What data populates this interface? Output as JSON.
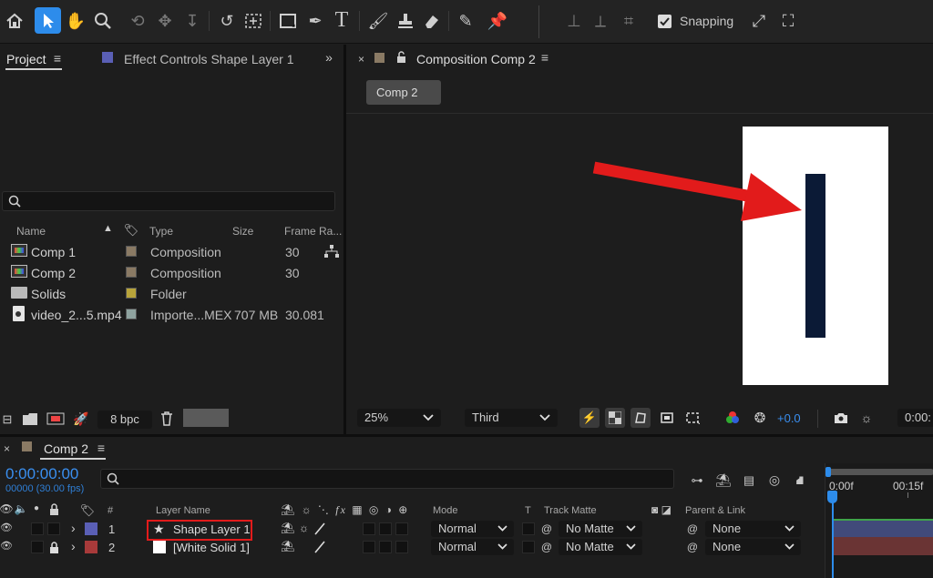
{
  "toolbar": {
    "snapping_label": "Snapping",
    "snapping_checked": true
  },
  "project_panel": {
    "tab_project": "Project",
    "tab_effect_controls": "Effect Controls Shape Layer 1",
    "columns": {
      "name": "Name",
      "type": "Type",
      "size": "Size",
      "frame_rate": "Frame Ra..."
    },
    "items": [
      {
        "name": "Comp 1",
        "type": "Composition",
        "size": "",
        "fps": "30",
        "label_color": "#8a7a64",
        "icon": "composition-icon"
      },
      {
        "name": "Comp 2",
        "type": "Composition",
        "size": "",
        "fps": "30",
        "label_color": "#8a7a64",
        "icon": "composition-icon"
      },
      {
        "name": "Solids",
        "type": "Folder",
        "size": "",
        "fps": "",
        "label_color": "#b8a43a",
        "icon": "folder-icon"
      },
      {
        "name": "video_2...5.mp4",
        "type": "Importe...MEX",
        "size": "707 MB",
        "fps": "30.081",
        "label_color": "#8fa3a0",
        "icon": "video-file-icon"
      }
    ],
    "bpc": "8 bpc"
  },
  "composition_panel": {
    "title": "Composition Comp 2",
    "comp_tab": "Comp 2",
    "zoom": "25%",
    "resolution": "Third",
    "exposure": "+0.0",
    "timecode": "0:00:"
  },
  "timeline": {
    "tab": "Comp 2",
    "timecode": "0:00:00:00",
    "frame_info": "00000 (30.00 fps)",
    "columns": {
      "num": "#",
      "layer_name": "Layer Name",
      "mode": "Mode",
      "t": "T",
      "track_matte": "Track Matte",
      "parent": "Parent & Link"
    },
    "ruler": {
      "start": "0:00f",
      "mark": "00:15f"
    },
    "layers": [
      {
        "num": "1",
        "name": "Shape Layer 1",
        "mode": "Normal",
        "matte": "No Matte",
        "parent": "None",
        "color": "#5a5fb5",
        "locked": false
      },
      {
        "num": "2",
        "name": "[White Solid 1]",
        "mode": "Normal",
        "matte": "No Matte",
        "parent": "None",
        "color": "#a83a3a",
        "locked": true
      }
    ]
  },
  "colors": {
    "accent": "#2d8ceb",
    "annotation_red": "#e21b1b",
    "shape_fill": "#0b1a36"
  }
}
